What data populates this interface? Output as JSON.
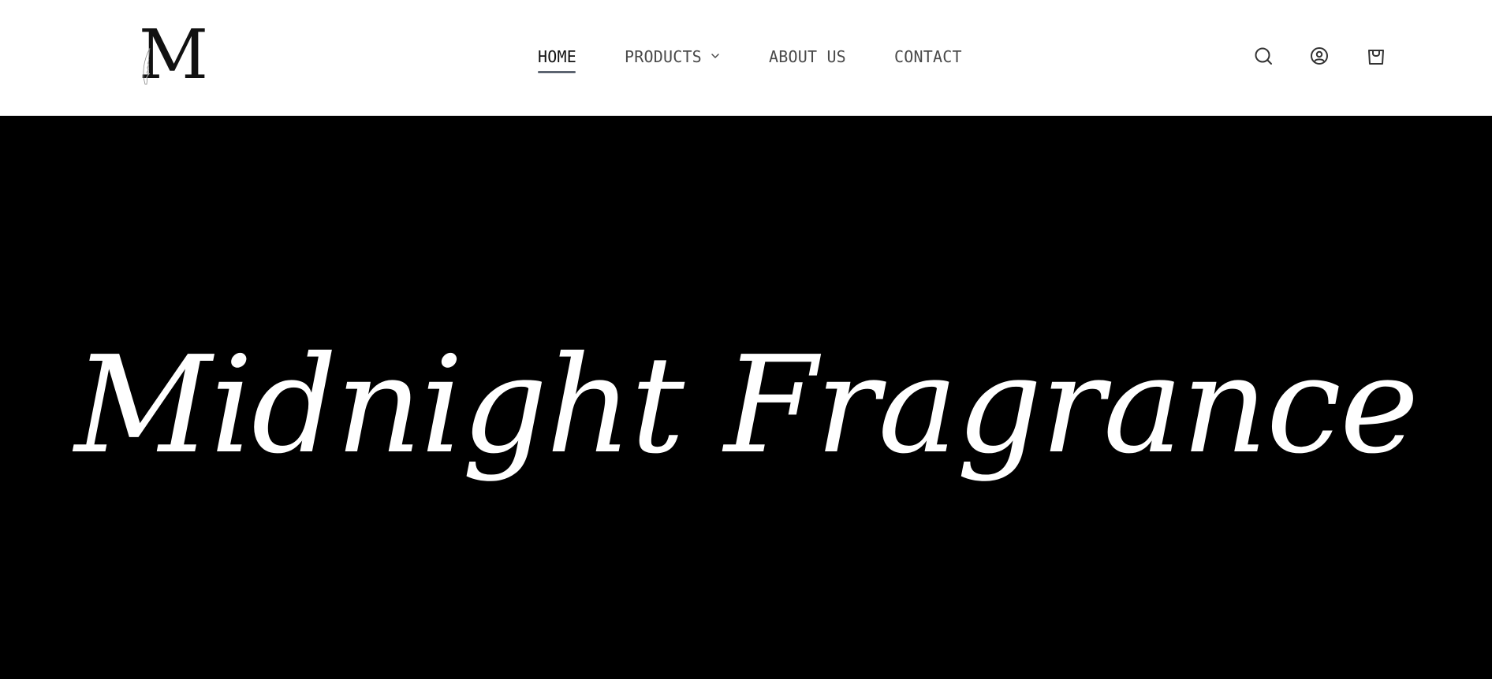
{
  "header": {
    "logo": {
      "letter": "M",
      "icon": "logo-monogram"
    },
    "nav": {
      "items": [
        {
          "label": "HOME",
          "active": true
        },
        {
          "label": "PRODUCTS",
          "active": false,
          "has_dropdown": true
        },
        {
          "label": "ABOUT US",
          "active": false
        },
        {
          "label": "CONTACT",
          "active": false
        }
      ]
    },
    "icons": [
      "search-icon",
      "account-icon",
      "cart-icon"
    ]
  },
  "hero": {
    "title": "Midnight Fragrance",
    "background_color": "#000000",
    "text_color": "#ffffff"
  },
  "colors": {
    "header_bg": "#ffffff",
    "nav_text": "#4a4a4a",
    "nav_active": "#111111",
    "underline": "#5c6470"
  }
}
